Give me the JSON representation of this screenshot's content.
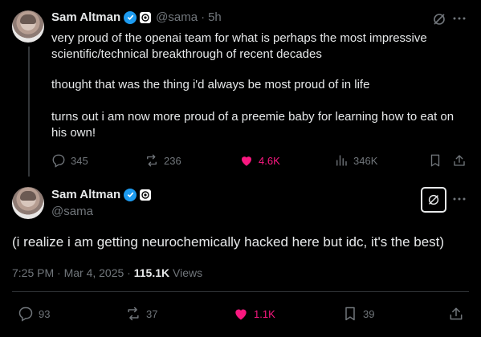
{
  "tweet1": {
    "name": "Sam Altman",
    "handle": "@sama",
    "separator": "·",
    "time": "5h",
    "text_p1": "very proud of the openai team for what is perhaps the most impressive scientific/technical breakthrough of recent decades",
    "text_p2": "thought that was the thing i'd always be most proud of in life",
    "text_p3": "turns out i am now more proud of a preemie baby for learning how to eat on his own!",
    "actions": {
      "replies": "345",
      "reposts": "236",
      "likes": "4.6K",
      "views": "346K"
    }
  },
  "tweet2": {
    "name": "Sam Altman",
    "handle": "@sama",
    "text": "(i realize i am getting neurochemically hacked here but idc, it's the best)",
    "meta_time": "7:25 PM · Mar 4, 2025 ·",
    "meta_views_count": "115.1K",
    "meta_views_label": "Views",
    "actions": {
      "replies": "93",
      "reposts": "37",
      "likes": "1.1K",
      "bookmarks": "39"
    }
  },
  "colors": {
    "background": "#000000",
    "text": "#e7e9ea",
    "muted": "#71767b",
    "like": "#f91880",
    "verified": "#1d9bf0"
  },
  "icons": [
    "verified-icon",
    "org-badge-icon",
    "grok-icon",
    "more-icon",
    "reply-icon",
    "repost-icon",
    "like-icon",
    "views-icon",
    "bookmark-icon",
    "share-icon"
  ]
}
